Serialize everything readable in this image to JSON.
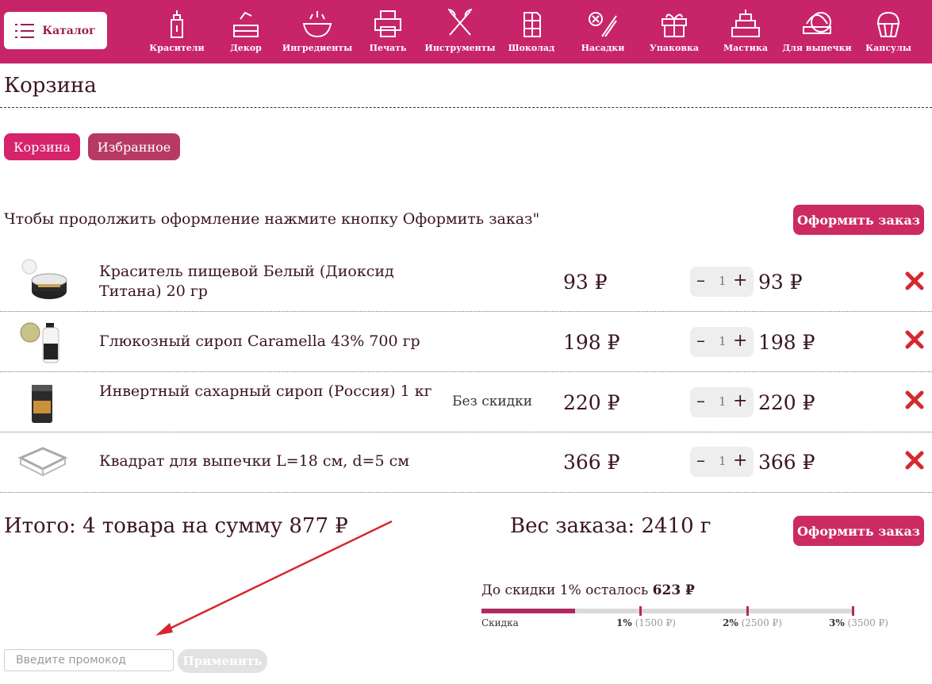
{
  "header": {
    "catalog_label": "Каталог",
    "nav": [
      {
        "label": "Красители",
        "icon": "dye-bottle-icon"
      },
      {
        "label": "Декор",
        "icon": "decor-cake-icon"
      },
      {
        "label": "Ингредиенты",
        "icon": "ingredients-bowl-icon"
      },
      {
        "label": "Печать",
        "icon": "printer-icon"
      },
      {
        "label": "Инструменты",
        "icon": "whisk-tools-icon"
      },
      {
        "label": "Шоколад",
        "icon": "chocolate-bar-icon"
      },
      {
        "label": "Насадки",
        "icon": "piping-nozzle-icon"
      },
      {
        "label": "Упаковка",
        "icon": "gift-box-icon"
      },
      {
        "label": "Мастика",
        "icon": "tiered-cake-icon"
      },
      {
        "label": "Для выпечки",
        "icon": "baking-pans-icon"
      },
      {
        "label": "Капсулы",
        "icon": "cupcake-capsule-icon"
      }
    ],
    "bar_color": "#c8246a"
  },
  "page": {
    "title": "Корзина",
    "tabs": {
      "cart": "Корзина",
      "favorites": "Избранное"
    },
    "hint": "Чтобы продолжить оформление нажмите кнопку Оформить заказ\"",
    "order_button": "Оформить заказ"
  },
  "cart": {
    "items": [
      {
        "name": "Краситель пищевой Белый (Диоксид Титана) 20 гр",
        "note": "",
        "price": "93 ₽",
        "qty": "1",
        "sum": "93 ₽"
      },
      {
        "name": "Глюкозный сироп Caramella 43% 700 гр",
        "note": "",
        "price": "198 ₽",
        "qty": "1",
        "sum": "198 ₽"
      },
      {
        "name": "Инвертный сахарный сироп (Россия) 1 кг",
        "note": "Без скидки",
        "price": "220 ₽",
        "qty": "1",
        "sum": "220 ₽"
      },
      {
        "name": "Квадрат для выпечки L=18 см, d=5 см",
        "note": "",
        "price": "366 ₽",
        "qty": "1",
        "sum": "366 ₽"
      }
    ],
    "minus": "–",
    "plus": "+",
    "total": "Итого: 4 товара на сумму 877 ₽",
    "weight": "Вес заказа: 2410 г"
  },
  "discount": {
    "prefix": "До скидки 1% осталось",
    "remaining": "623 ₽",
    "progress_fraction": 0.25,
    "label": "Скидка",
    "levels": [
      {
        "pct": "1%",
        "amount": "(1500 ₽)"
      },
      {
        "pct": "2%",
        "amount": "(2500 ₽)"
      },
      {
        "pct": "3%",
        "amount": "(3500 ₽)"
      }
    ]
  },
  "promo": {
    "placeholder": "Введите промокод",
    "apply_label": "Применить"
  }
}
